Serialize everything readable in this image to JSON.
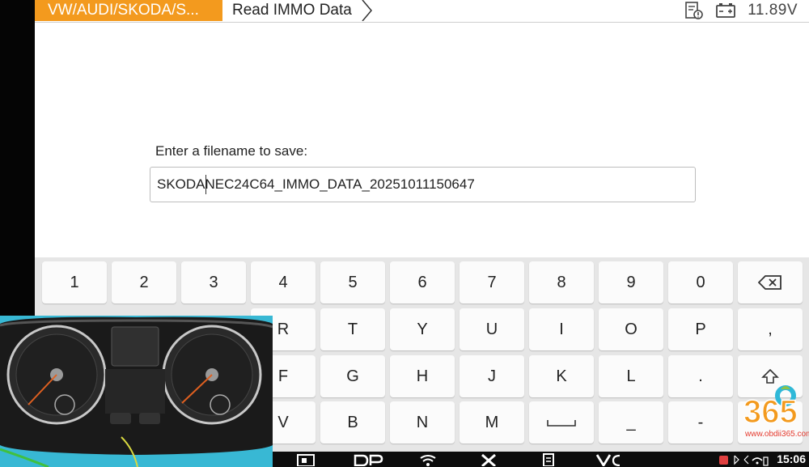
{
  "header": {
    "breadcrumb_1": "VW/AUDI/SKODA/S...",
    "breadcrumb_2": "Read IMMO Data",
    "voltage": "11.89V"
  },
  "form": {
    "label": "Enter a filename to save:",
    "filename_value": "SKODANEC24C64_IMMO_DATA_20251011150647"
  },
  "keyboard": {
    "row1": [
      "1",
      "2",
      "3",
      "4",
      "5",
      "6",
      "7",
      "8",
      "9",
      "0"
    ],
    "row2": [
      "R",
      "T",
      "Y",
      "U",
      "I",
      "O",
      "P",
      ","
    ],
    "row3": [
      "F",
      "G",
      "H",
      "J",
      "K",
      "L",
      "."
    ],
    "row4": [
      "V",
      "B",
      "N",
      "M",
      "_",
      "-"
    ]
  },
  "navbar": {
    "clock": "15:06"
  },
  "watermark": {
    "logo_text": "365",
    "url": "www.obdii365.com"
  },
  "colors": {
    "accent": "#f39a1e",
    "keyboard_bg": "#e6e6e6",
    "key_bg": "#fbfbfb",
    "camera_bg": "#38b8d4",
    "watermark": "#e53b2f"
  }
}
